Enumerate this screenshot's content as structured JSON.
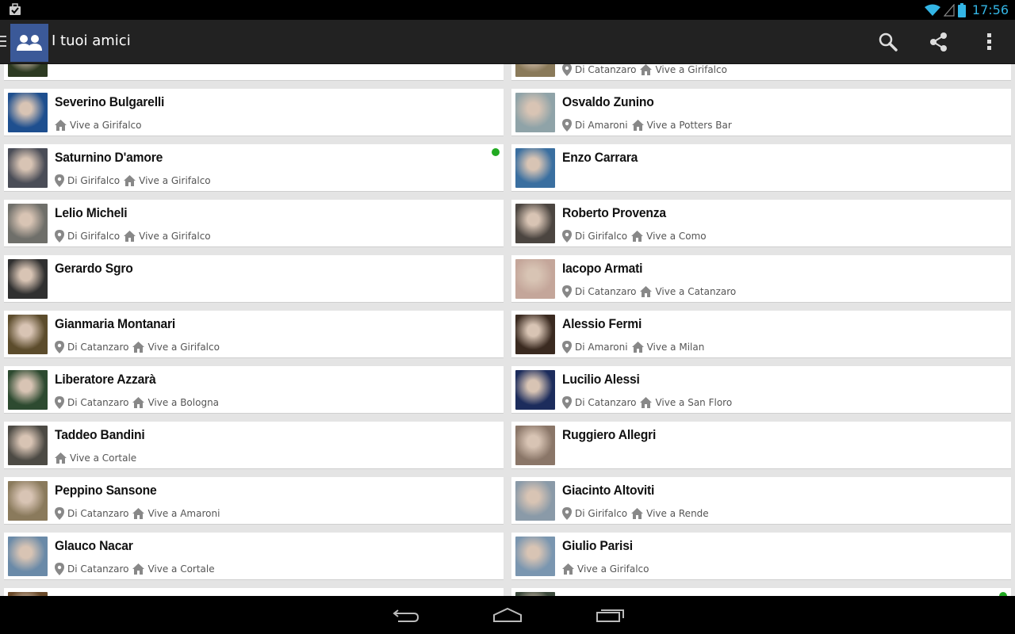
{
  "status_bar": {
    "time": "17:56",
    "icons": [
      "notification-bag-icon",
      "wifi-icon",
      "signal-icon",
      "battery-icon"
    ],
    "accent": "#33b5e5"
  },
  "action_bar": {
    "title": "I tuoi amici",
    "actions": [
      "search-icon",
      "share-icon",
      "overflow-menu-icon"
    ],
    "app_icon_color": "#3b5998"
  },
  "friends": [
    {
      "name": "",
      "from": "",
      "lives": "",
      "online": false
    },
    {
      "name": "",
      "from": "Di Catanzaro",
      "lives": "Vive a Girifalco",
      "online": false
    },
    {
      "name": "Severino Bulgarelli",
      "from": "",
      "lives": "Vive a Girifalco",
      "online": false
    },
    {
      "name": "Osvaldo Zunino",
      "from": "Di Amaroni",
      "lives": "Vive a Potters Bar",
      "online": false
    },
    {
      "name": "Saturnino D'amore",
      "from": "Di Girifalco",
      "lives": "Vive a Girifalco",
      "online": true
    },
    {
      "name": "Enzo Carrara",
      "from": "",
      "lives": "",
      "online": false
    },
    {
      "name": "Lelio Micheli",
      "from": "Di Girifalco",
      "lives": "Vive a Girifalco",
      "online": false
    },
    {
      "name": "Roberto Provenza",
      "from": "Di Girifalco",
      "lives": "Vive a Como",
      "online": false
    },
    {
      "name": "Gerardo Sgro",
      "from": "",
      "lives": "",
      "online": false
    },
    {
      "name": "Iacopo Armati",
      "from": "Di Catanzaro",
      "lives": "Vive a Catanzaro",
      "online": false
    },
    {
      "name": "Gianmaria Montanari",
      "from": "Di Catanzaro",
      "lives": "Vive a Girifalco",
      "online": false
    },
    {
      "name": "Alessio Fermi",
      "from": "Di Amaroni",
      "lives": "Vive a Milan",
      "online": false
    },
    {
      "name": "Liberatore Azzarà",
      "from": "Di Catanzaro",
      "lives": "Vive a Bologna",
      "online": false
    },
    {
      "name": "Lucilio Alessi",
      "from": "Di Catanzaro",
      "lives": "Vive a San Floro",
      "online": false
    },
    {
      "name": "Taddeo Bandini",
      "from": "",
      "lives": "Vive a Cortale",
      "online": false
    },
    {
      "name": "Ruggiero Allegri",
      "from": "",
      "lives": "",
      "online": false
    },
    {
      "name": "Peppino Sansone",
      "from": "Di Catanzaro",
      "lives": "Vive a Amaroni",
      "online": false
    },
    {
      "name": "Giacinto Altoviti",
      "from": "Di Girifalco",
      "lives": "Vive a Rende",
      "online": false
    },
    {
      "name": "Glauco Nacar",
      "from": "Di Catanzaro",
      "lives": "Vive a Cortale",
      "online": false
    },
    {
      "name": "Giulio Parisi",
      "from": "",
      "lives": "Vive a Girifalco",
      "online": false
    },
    {
      "name": "",
      "from": "",
      "lives": "",
      "online": false
    },
    {
      "name": "",
      "from": "",
      "lives": "",
      "online": true
    }
  ],
  "avatar_colors": [
    "#2d3a22",
    "#8a7a5a",
    "#1e4f8f",
    "#8fa3a8",
    "#4a4d57",
    "#3a6fa0",
    "#6f6f6a",
    "#4b4540",
    "#303030",
    "#c4a69a",
    "#5c4c2c",
    "#3a2a20",
    "#2d4a30",
    "#1c2c5c",
    "#4c4a44",
    "#8a7668",
    "#8a7a5c",
    "#8a9aa8",
    "#6a8aa8",
    "#7a96b0",
    "#6a4a2a",
    "#3c4a3c"
  ],
  "navigation_bar": {
    "buttons": [
      "back-icon",
      "home-icon",
      "recents-icon"
    ]
  },
  "colors": {
    "online": "#22aa22",
    "action_bar": "#222222",
    "list_background": "#e4e4e4"
  }
}
